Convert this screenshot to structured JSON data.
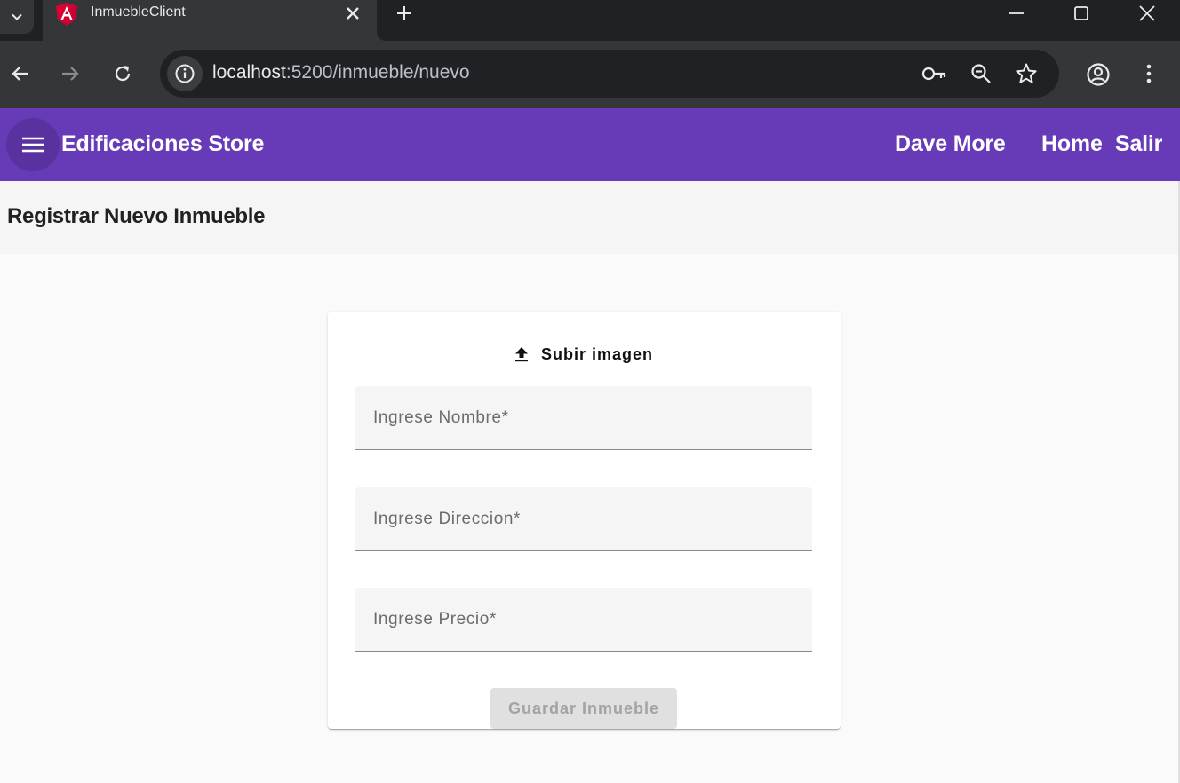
{
  "browser": {
    "tab_title": "InmuebleClient",
    "url_host": "localhost",
    "url_path": ":5200/inmueble/nuevo",
    "icons": [
      "tab-search-icon",
      "angular-favicon",
      "close-icon",
      "plus-icon",
      "minimize-icon",
      "maximize-icon",
      "window-close-icon",
      "back-arrow-icon",
      "forward-arrow-icon",
      "reload-icon",
      "info-icon",
      "key-icon",
      "zoom-out-icon",
      "star-icon",
      "account-icon",
      "more-vert-icon"
    ]
  },
  "appbar": {
    "brand": "Edificaciones Store",
    "user": "Dave More",
    "home": "Home",
    "logout": "Salir",
    "color": "#673ab7"
  },
  "page": {
    "title": "Registrar Nuevo Inmueble"
  },
  "form": {
    "upload_label": "Subir imagen",
    "nombre_placeholder": "Ingrese Nombre*",
    "direccion_placeholder": "Ingrese Direccion*",
    "precio_placeholder": "Ingrese Precio*",
    "save_label": "Guardar Inmueble"
  }
}
